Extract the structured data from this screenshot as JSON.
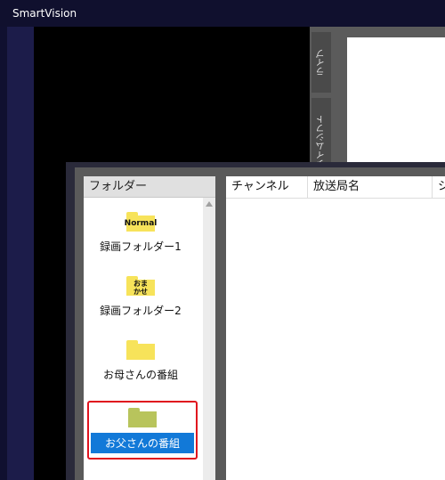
{
  "app": {
    "title": "SmartVision"
  },
  "side_tabs": {
    "live": "ライブ",
    "timeshift": "タイムシフト"
  },
  "folder_pane": {
    "header": "フォルダー",
    "items": [
      {
        "label": "録画フォルダー1",
        "icon_text": "Normal",
        "icon": "folder-normal-icon",
        "color": "#f7e35a"
      },
      {
        "label": "録画フォルダー2",
        "icon_text": "おまかせ",
        "icon": "folder-omakase-icon",
        "color": "#f7e35a"
      },
      {
        "label": "お母さんの番組",
        "icon_text": "",
        "icon": "folder-icon",
        "color": "#f7e35a"
      },
      {
        "label": "お父さんの番組",
        "icon_text": "",
        "icon": "folder-icon",
        "color": "#b8c45c",
        "selected": true
      }
    ]
  },
  "program_pane": {
    "columns": [
      "チャンネル",
      "放送局名",
      "シ"
    ]
  },
  "colors": {
    "selection": "#1279d8",
    "highlight_border": "#e0141e",
    "background": "#1c1c4a"
  }
}
